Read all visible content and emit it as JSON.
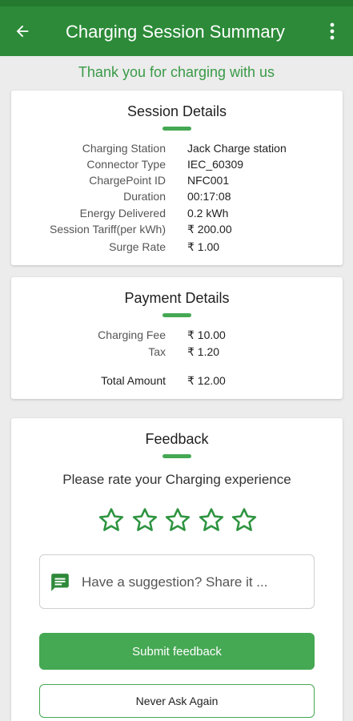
{
  "app_bar": {
    "title": "Charging Session Summary",
    "back_icon": "arrow-left-icon",
    "menu_icon": "more-vertical-icon",
    "color": "#2c8a38"
  },
  "thanks_text": "Thank you for charging with us",
  "session": {
    "title": "Session Details",
    "rows": [
      {
        "label": "Charging Station",
        "value": "Jack Charge station"
      },
      {
        "label": "Connector Type",
        "value": "IEC_60309"
      },
      {
        "label": "ChargePoint ID",
        "value": "NFC001"
      },
      {
        "label": "Duration",
        "value": "00:17:08"
      },
      {
        "label": "Energy Delivered",
        "value": "0.2 kWh"
      },
      {
        "label": "Session Tariff(per kWh)",
        "value": "₹ 200.00"
      },
      {
        "label": "Surge Rate",
        "value": "₹ 1.00"
      }
    ]
  },
  "payment": {
    "title": "Payment Details",
    "rows": [
      {
        "label": "Charging Fee",
        "value": "₹ 10.00"
      },
      {
        "label": "Tax",
        "value": "₹ 1.20"
      }
    ],
    "total": {
      "label": "Total Amount",
      "value": "₹ 12.00"
    }
  },
  "feedback": {
    "title": "Feedback",
    "prompt": "Please rate your Charging experience",
    "rating": 0,
    "max_rating": 5,
    "suggestion_placeholder": "Have a suggestion? Share it ...",
    "submit_label": "Submit feedback",
    "never_label": "Never Ask Again",
    "accent": "#45a853"
  }
}
